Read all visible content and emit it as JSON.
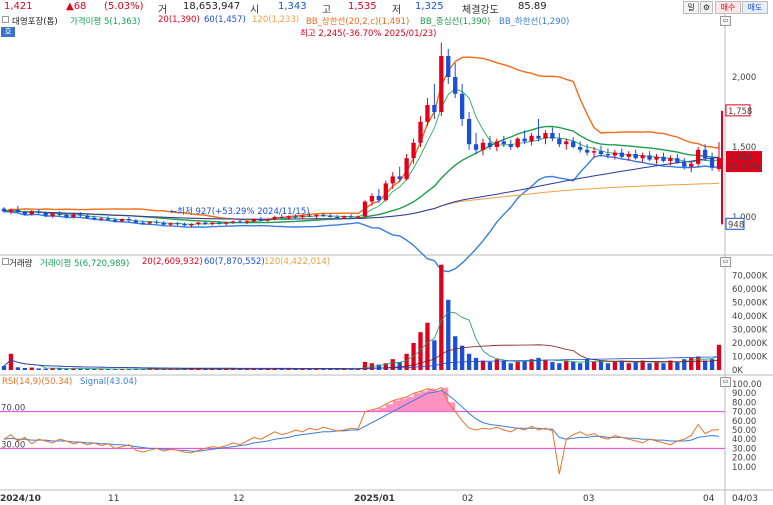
{
  "header": {
    "price": "1,421",
    "change": "▲68",
    "change_pct": "(5.03%)",
    "volume_label": "거",
    "volume": "18,653,947",
    "open_label": "시",
    "open": "1,343",
    "high_label": "고",
    "high": "1,535",
    "low_label": "저",
    "low": "1,325",
    "strength_label": "체결강도",
    "strength": "85.89",
    "period_button": "일",
    "settings_icon": "gear-icon",
    "buy_button": "매수",
    "sell_button": "매도"
  },
  "colors": {
    "up": "#e0001b",
    "down": "#1a4fd6",
    "ma5": "#13a35a",
    "ma20": "#e0001b",
    "ma60": "#1a4fd6",
    "ma120": "#f0a040",
    "bb_upper": "#f06a1a",
    "bb_mid": "#1e9e4a",
    "bb_lower": "#3a7de0",
    "rsi": "#e8742a",
    "signal": "#3a7de0",
    "rsi_fill": "#ff7eb8"
  },
  "price_legend": {
    "name": "대영포장(톱)",
    "ma5": "가격이평 5(1,363)",
    "ma20": "20(1,390)",
    "ma60": "60(1,457)",
    "ma120": "120(1,233)",
    "bb_upper": "BB_상한선(20,2,c)(1,491)",
    "bb_mid": "BB_중심선(1,390)",
    "bb_lower": "BB_하한선(1,290)",
    "code_badge": "호"
  },
  "volume_legend": {
    "title": "거래량",
    "ma5": "거래이평 5(6,720,989)",
    "ma20": "20(2,609,932)",
    "ma60": "60(7,870,552)",
    "ma120": "120(4,422,014)"
  },
  "rsi_legend": {
    "rsi": "RSI(14,9)(50.34)",
    "signal": "Signal(43.04)"
  },
  "annotations": {
    "high_marker": "최고 2,245(-36.70% 2025/01/23)",
    "low_marker": "←최저 927(+53.29% 2024/11/15)",
    "price_tag": "1,421",
    "price_tag_pct": "(5.03%)",
    "upper_tag": "1,758",
    "lower_tag": "948",
    "rsi_70": "70.00",
    "rsi_30": "30.00"
  },
  "price_axis": {
    "ticks": [
      "2,000",
      "1,500",
      "1,000"
    ],
    "ylim": [
      750,
      2350
    ]
  },
  "volume_axis": {
    "ticks": [
      "70,000K",
      "60,000K",
      "50,000K",
      "40,000K",
      "30,000K",
      "20,000K",
      "10,000K",
      "0K"
    ],
    "ylim": [
      0,
      80000
    ]
  },
  "rsi_axis": {
    "ticks": [
      "100.00",
      "90.00",
      "80.00",
      "70.00",
      "60.00",
      "50.00",
      "40.00",
      "30.00",
      "20.00",
      "10.00"
    ],
    "ylim": [
      0,
      100
    ]
  },
  "x_axis": {
    "labels": [
      "2024/10",
      "11",
      "12",
      "2025/01",
      "02",
      "03",
      "04",
      "04/03"
    ]
  },
  "chart_data": {
    "type": "candlestick",
    "candles": [
      [
        1060,
        1070,
        1030,
        1040
      ],
      [
        1040,
        1060,
        1020,
        1050
      ],
      [
        1050,
        1080,
        1030,
        1035
      ],
      [
        1035,
        1045,
        1010,
        1020
      ],
      [
        1020,
        1050,
        1010,
        1040
      ],
      [
        1040,
        1055,
        1020,
        1030
      ],
      [
        1030,
        1040,
        1000,
        1010
      ],
      [
        1010,
        1030,
        995,
        1025
      ],
      [
        1025,
        1040,
        1005,
        1015
      ],
      [
        1015,
        1025,
        990,
        1000
      ],
      [
        1000,
        1030,
        990,
        1020
      ],
      [
        1020,
        1035,
        1000,
        1010
      ],
      [
        1010,
        1020,
        985,
        995
      ],
      [
        995,
        1010,
        975,
        985
      ],
      [
        985,
        1000,
        970,
        990
      ],
      [
        990,
        1005,
        975,
        980
      ],
      [
        980,
        995,
        960,
        970
      ],
      [
        970,
        990,
        960,
        985
      ],
      [
        985,
        1000,
        965,
        975
      ],
      [
        975,
        985,
        955,
        960
      ],
      [
        960,
        975,
        945,
        955
      ],
      [
        955,
        970,
        945,
        965
      ],
      [
        965,
        980,
        950,
        960
      ],
      [
        960,
        970,
        940,
        945
      ],
      [
        945,
        960,
        935,
        955
      ],
      [
        955,
        965,
        940,
        950
      ],
      [
        950,
        960,
        935,
        940
      ],
      [
        940,
        955,
        927,
        950
      ],
      [
        950,
        965,
        940,
        960
      ],
      [
        960,
        970,
        945,
        950
      ],
      [
        950,
        965,
        940,
        958
      ],
      [
        958,
        970,
        945,
        952
      ],
      [
        952,
        965,
        940,
        960
      ],
      [
        960,
        975,
        950,
        968
      ],
      [
        968,
        980,
        955,
        962
      ],
      [
        962,
        975,
        950,
        970
      ],
      [
        970,
        990,
        960,
        985
      ],
      [
        985,
        1000,
        970,
        975
      ],
      [
        975,
        990,
        965,
        985
      ],
      [
        985,
        1010,
        975,
        1000
      ],
      [
        1000,
        1020,
        990,
        995
      ],
      [
        995,
        1010,
        980,
        1005
      ],
      [
        1005,
        1020,
        990,
        1000
      ],
      [
        1000,
        1015,
        985,
        1010
      ],
      [
        1010,
        1030,
        1000,
        1005
      ],
      [
        1005,
        1020,
        990,
        1015
      ],
      [
        1015,
        1030,
        1000,
        1010
      ],
      [
        1010,
        1020,
        995,
        1000
      ],
      [
        1000,
        1015,
        985,
        995
      ],
      [
        995,
        1010,
        985,
        1005
      ],
      [
        1005,
        1020,
        995,
        1000
      ],
      [
        1000,
        1010,
        990,
        1005
      ],
      [
        1005,
        1120,
        1000,
        1110
      ],
      [
        1110,
        1170,
        1080,
        1150
      ],
      [
        1150,
        1200,
        1100,
        1120
      ],
      [
        1120,
        1260,
        1110,
        1240
      ],
      [
        1240,
        1320,
        1200,
        1290
      ],
      [
        1290,
        1360,
        1250,
        1270
      ],
      [
        1270,
        1450,
        1260,
        1420
      ],
      [
        1420,
        1560,
        1380,
        1530
      ],
      [
        1530,
        1720,
        1500,
        1680
      ],
      [
        1680,
        1850,
        1650,
        1800
      ],
      [
        1800,
        1950,
        1700,
        1750
      ],
      [
        1750,
        2245,
        1720,
        2150
      ],
      [
        2150,
        2200,
        1950,
        2000
      ],
      [
        2000,
        2100,
        1850,
        1880
      ],
      [
        1880,
        1950,
        1650,
        1700
      ],
      [
        1700,
        1750,
        1480,
        1520
      ],
      [
        1520,
        1600,
        1450,
        1480
      ],
      [
        1480,
        1560,
        1440,
        1530
      ],
      [
        1530,
        1580,
        1480,
        1500
      ],
      [
        1500,
        1560,
        1470,
        1540
      ],
      [
        1540,
        1580,
        1500,
        1520
      ],
      [
        1520,
        1550,
        1480,
        1500
      ],
      [
        1500,
        1570,
        1490,
        1560
      ],
      [
        1560,
        1620,
        1520,
        1540
      ],
      [
        1540,
        1600,
        1510,
        1580
      ],
      [
        1580,
        1700,
        1540,
        1560
      ],
      [
        1560,
        1620,
        1520,
        1600
      ],
      [
        1600,
        1640,
        1540,
        1560
      ],
      [
        1560,
        1600,
        1500,
        1520
      ],
      [
        1520,
        1560,
        1480,
        1540
      ],
      [
        1540,
        1570,
        1490,
        1500
      ],
      [
        1500,
        1540,
        1460,
        1480
      ],
      [
        1480,
        1520,
        1440,
        1460
      ],
      [
        1460,
        1500,
        1420,
        1470
      ],
      [
        1470,
        1510,
        1430,
        1450
      ],
      [
        1450,
        1490,
        1420,
        1440
      ],
      [
        1440,
        1480,
        1410,
        1460
      ],
      [
        1460,
        1490,
        1420,
        1430
      ],
      [
        1430,
        1470,
        1400,
        1450
      ],
      [
        1450,
        1480,
        1410,
        1420
      ],
      [
        1420,
        1460,
        1390,
        1440
      ],
      [
        1440,
        1470,
        1400,
        1410
      ],
      [
        1410,
        1450,
        1380,
        1430
      ],
      [
        1430,
        1460,
        1390,
        1400
      ],
      [
        1400,
        1440,
        1370,
        1420
      ],
      [
        1420,
        1450,
        1380,
        1390
      ],
      [
        1390,
        1420,
        1340,
        1360
      ],
      [
        1360,
        1400,
        1320,
        1380
      ],
      [
        1380,
        1500,
        1360,
        1480
      ],
      [
        1480,
        1520,
        1400,
        1420
      ],
      [
        1420,
        1460,
        1330,
        1353
      ],
      [
        1343,
        1535,
        1325,
        1421
      ]
    ],
    "volume_k": [
      3000,
      12000,
      2000,
      1500,
      1800,
      1200,
      1000,
      1500,
      1100,
      900,
      1200,
      1000,
      800,
      900,
      700,
      800,
      600,
      700,
      900,
      600,
      500,
      700,
      600,
      500,
      700,
      600,
      500,
      1500,
      900,
      700,
      800,
      700,
      800,
      900,
      700,
      800,
      1200,
      900,
      800,
      1100,
      900,
      800,
      700,
      900,
      800,
      700,
      800,
      700,
      600,
      700,
      800,
      600,
      6000,
      5000,
      4000,
      5000,
      8000,
      6000,
      12000,
      20000,
      28000,
      35000,
      22000,
      78000,
      52000,
      25000,
      18000,
      12000,
      9000,
      7000,
      6000,
      8000,
      7000,
      5000,
      6000,
      7000,
      8000,
      9000,
      7000,
      6000,
      5000,
      7000,
      6000,
      5000,
      8000,
      6000,
      7000,
      5000,
      6000,
      7000,
      5000,
      6000,
      7000,
      5000,
      6000,
      5000,
      7000,
      6000,
      8000,
      9000,
      10000,
      7000,
      8000,
      18653
    ],
    "rsi": [
      40,
      45,
      38,
      42,
      35,
      40,
      38,
      36,
      40,
      38,
      35,
      37,
      34,
      36,
      33,
      35,
      30,
      32,
      34,
      28,
      26,
      28,
      30,
      27,
      29,
      28,
      26,
      25,
      28,
      30,
      32,
      31,
      33,
      36,
      34,
      38,
      42,
      40,
      44,
      48,
      45,
      47,
      50,
      48,
      52,
      50,
      53,
      51,
      49,
      50,
      52,
      51,
      70,
      72,
      74,
      78,
      82,
      84,
      86,
      90,
      92,
      95,
      93,
      96,
      80,
      70,
      60,
      52,
      50,
      52,
      51,
      53,
      50,
      48,
      52,
      50,
      54,
      50,
      52,
      49,
      2,
      40,
      45,
      48,
      44,
      46,
      42,
      40,
      44,
      42,
      40,
      38,
      36,
      40,
      38,
      36,
      34,
      38,
      40,
      44,
      56,
      46,
      50,
      50.34
    ],
    "signal": [
      40,
      41,
      40,
      40,
      39,
      39,
      39,
      38,
      38,
      38,
      37,
      37,
      36,
      36,
      35,
      35,
      34,
      34,
      33,
      32,
      31,
      30,
      30,
      29,
      29,
      28,
      28,
      27,
      27,
      28,
      29,
      30,
      31,
      32,
      33,
      34,
      36,
      37,
      38,
      40,
      41,
      42,
      44,
      45,
      46,
      47,
      48,
      48,
      49,
      49,
      50,
      50,
      54,
      58,
      62,
      66,
      70,
      74,
      78,
      82,
      86,
      90,
      91,
      93,
      88,
      82,
      75,
      68,
      62,
      58,
      56,
      55,
      54,
      53,
      52,
      52,
      52,
      52,
      51,
      51,
      42,
      40,
      41,
      42,
      42,
      43,
      43,
      42,
      42,
      42,
      41,
      41,
      40,
      40,
      39,
      39,
      38,
      38,
      38,
      39,
      42,
      43,
      44,
      43.04
    ]
  }
}
